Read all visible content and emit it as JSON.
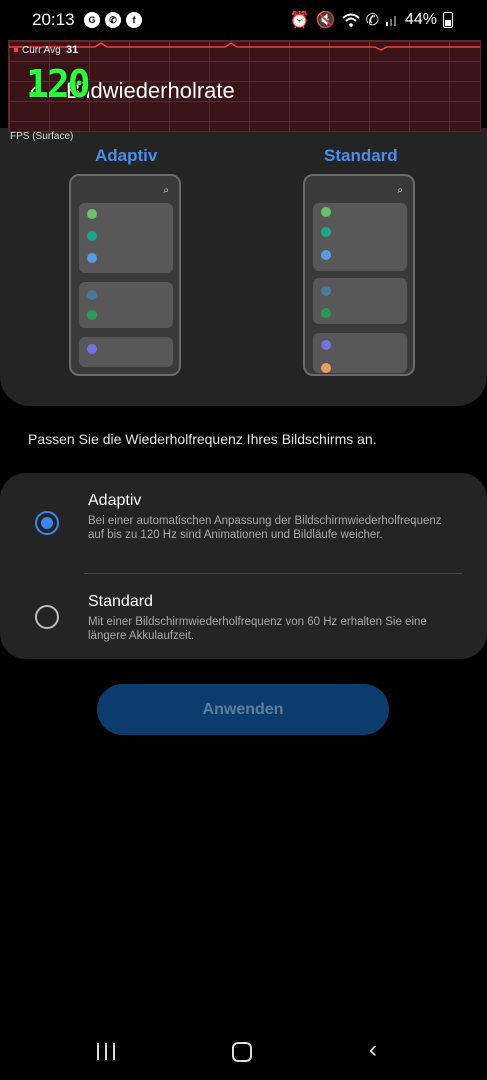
{
  "status_bar": {
    "time": "20:13",
    "battery": "44%",
    "left_icons": [
      "gpu-icon",
      "whatsapp-icon",
      "facebook-icon"
    ],
    "right_icons": [
      "alarm-icon",
      "mute-icon",
      "wifi-icon",
      "wifi-call-icon",
      "signal-icon",
      "battery-icon"
    ]
  },
  "fps_overlay": {
    "curr_avg_label": "Curr Avg",
    "curr_avg_value": "31",
    "fps_value": "120",
    "surface_label": "FPS (Surface)"
  },
  "header": {
    "title": "Bildwiederholrate"
  },
  "preview": {
    "left_label": "Adaptiv",
    "right_label": "Standard"
  },
  "description": "Passen Sie die Wiederholfrequenz Ihres Bildschirms an.",
  "options": [
    {
      "title": "Adaptiv",
      "description": "Bei einer automatischen Anpassung der Bildschirmwiederholfrequenz auf bis zu 120 Hz sind Animationen und Bildläufe weicher.",
      "selected": true
    },
    {
      "title": "Standard",
      "description": "Mit einer Bildschirmwiederholfrequenz von 60 Hz erhalten Sie eine längere Akkulaufzeit.",
      "selected": false
    }
  ],
  "apply_label": "Anwenden",
  "colors": {
    "accent": "#3b86f5",
    "fps_green": "#2aff3a",
    "card_bg": "#242424"
  }
}
